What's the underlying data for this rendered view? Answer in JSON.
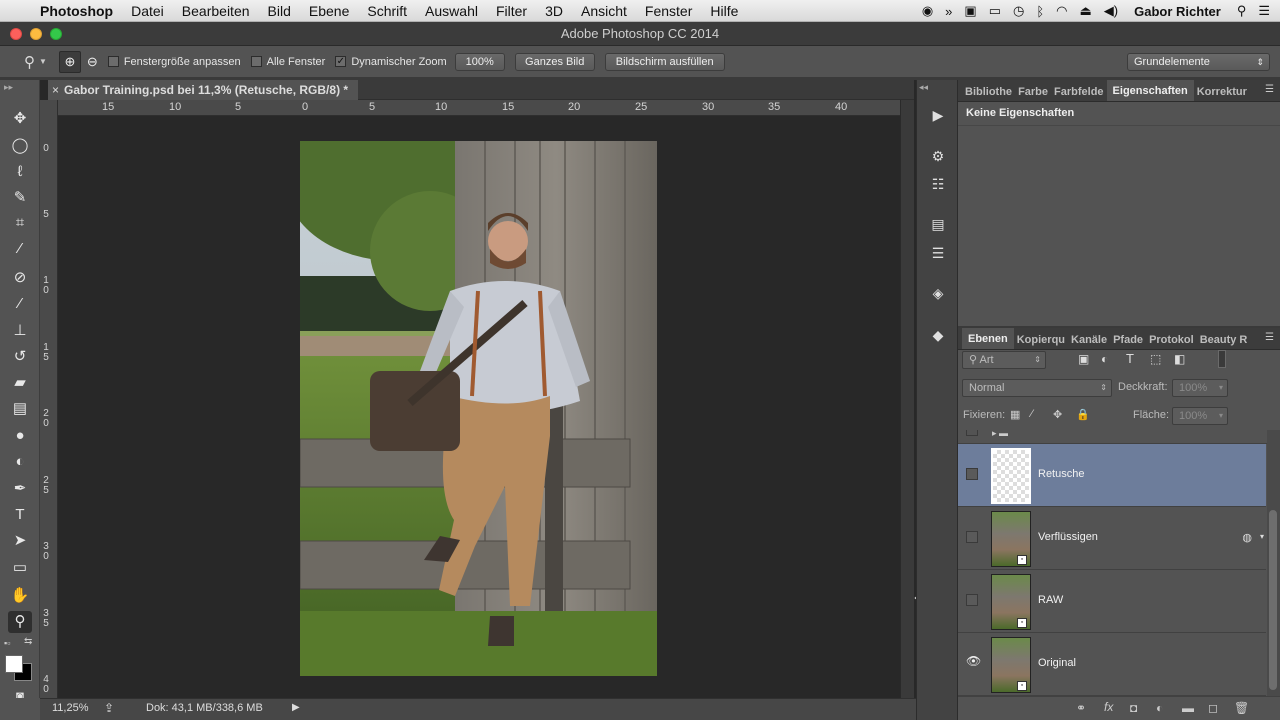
{
  "menubar": {
    "app_name": "Photoshop",
    "items": [
      "Datei",
      "Bearbeiten",
      "Bild",
      "Ebene",
      "Schrift",
      "Auswahl",
      "Filter",
      "3D",
      "Ansicht",
      "Fenster",
      "Hilfe"
    ],
    "user": "Gabor Richter"
  },
  "window": {
    "title": "Adobe Photoshop CC 2014"
  },
  "options": {
    "resize_windows": "Fenstergröße anpassen",
    "all_windows": "Alle Fenster",
    "scrubby_zoom": "Dynamischer Zoom",
    "zoom_100": "100%",
    "fit_screen": "Ganzes Bild",
    "fill_screen": "Bildschirm ausfüllen",
    "workspace": "Grundelemente"
  },
  "document": {
    "tab_title": "Gabor Training.psd bei 11,3% (Retusche, RGB/8) *",
    "zoom": "11,25%",
    "doc_size": "Dok: 43,1 MB/338,6 MB"
  },
  "ruler_top": [
    "15",
    "10",
    "5",
    "0",
    "5",
    "10",
    "15",
    "20",
    "25",
    "30",
    "35",
    "40"
  ],
  "ruler_left": [
    "0",
    "5",
    "1\n0",
    "1\n5",
    "2\n0",
    "2\n5",
    "3\n0",
    "3\n5",
    "4\n0"
  ],
  "properties": {
    "tabs": [
      "Bibliothe",
      "Farbe",
      "Farbfelde",
      "Eigenschaften",
      "Korrektur"
    ],
    "empty_text": "Keine Eigenschaften"
  },
  "layers": {
    "tabs": [
      "Ebenen",
      "Kopierqu",
      "Kanäle",
      "Pfade",
      "Protokol",
      "Beauty R"
    ],
    "filter_kind": "Art",
    "blend_mode": "Normal",
    "opacity_label": "Deckkraft:",
    "opacity_value": "100%",
    "lock_label": "Fixieren:",
    "fill_label": "Fläche:",
    "fill_value": "100%",
    "items": [
      {
        "name": "Retusche",
        "selected": true,
        "visible": false
      },
      {
        "name": "Verflüssigen",
        "selected": false,
        "visible": false
      },
      {
        "name": "RAW",
        "selected": false,
        "visible": false
      },
      {
        "name": "Original",
        "selected": false,
        "visible": true
      }
    ]
  },
  "colors": {
    "accent_selected_layer": "#6d7d9b",
    "panel_bg": "#535353"
  }
}
